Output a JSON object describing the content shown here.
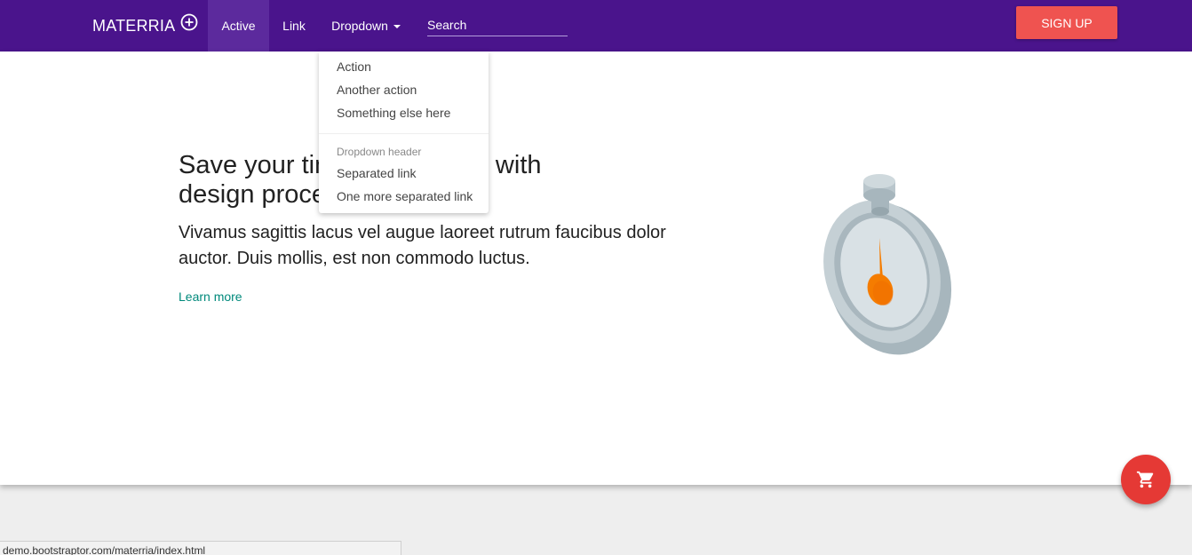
{
  "navbar": {
    "brand": "MATERRIA",
    "brand_icon": "plus-circle-icon",
    "items": [
      {
        "label": "Active",
        "active": true
      },
      {
        "label": "Link"
      },
      {
        "label": "Dropdown"
      }
    ],
    "search": {
      "placeholder": "Search",
      "value": ""
    },
    "signup_label": "SIGN UP",
    "colors": {
      "background": "#4a148c",
      "active": "#5c2a9d",
      "signup": "#ef5350"
    }
  },
  "dropdown": {
    "items": [
      "Action",
      "Another action",
      "Something else here"
    ],
    "header": "Dropdown header",
    "separated": [
      "Separated link",
      "One more separated link"
    ]
  },
  "hero": {
    "headline_line1": "Save your time. It's no pain with",
    "headline_line2": "design process.",
    "lead": "Vivamus sagittis lacus vel augue laoreet rutrum faucibus dolor auctor. Duis mollis, est non commodo luctus.",
    "link": "Learn more",
    "illustration": "stopwatch-icon",
    "link_color": "#00897b"
  },
  "fab": {
    "icon": "shopping-cart-icon",
    "color": "#e53935"
  },
  "status_bar": {
    "url": "demo.bootstraptor.com/materria/index.html"
  }
}
